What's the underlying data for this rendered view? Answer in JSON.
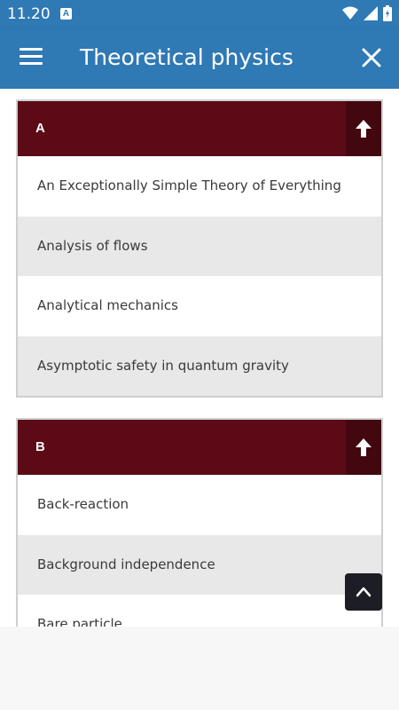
{
  "status_bar": {
    "time": "11.20",
    "notification_icon": "a-icon",
    "icons": [
      "wifi-icon",
      "signal-icon",
      "battery-icon"
    ]
  },
  "app_bar": {
    "title": "Theoretical physics",
    "menu_icon": "hamburger-menu-icon",
    "close_icon": "close-icon"
  },
  "sections": [
    {
      "letter": "A",
      "items": [
        "An Exceptionally Simple Theory of Everything",
        "Analysis of flows",
        "Analytical mechanics",
        "Asymptotic safety in quantum gravity"
      ]
    },
    {
      "letter": "B",
      "items": [
        "Back-reaction",
        "Background independence",
        "Bare particle"
      ]
    }
  ],
  "colors": {
    "app_bar": "#2f79b4",
    "section_header": "#5c0a15",
    "section_button": "#430710",
    "alt_row": "#e8e8e8"
  },
  "scroll_to_top_icon": "chevron-up-icon"
}
